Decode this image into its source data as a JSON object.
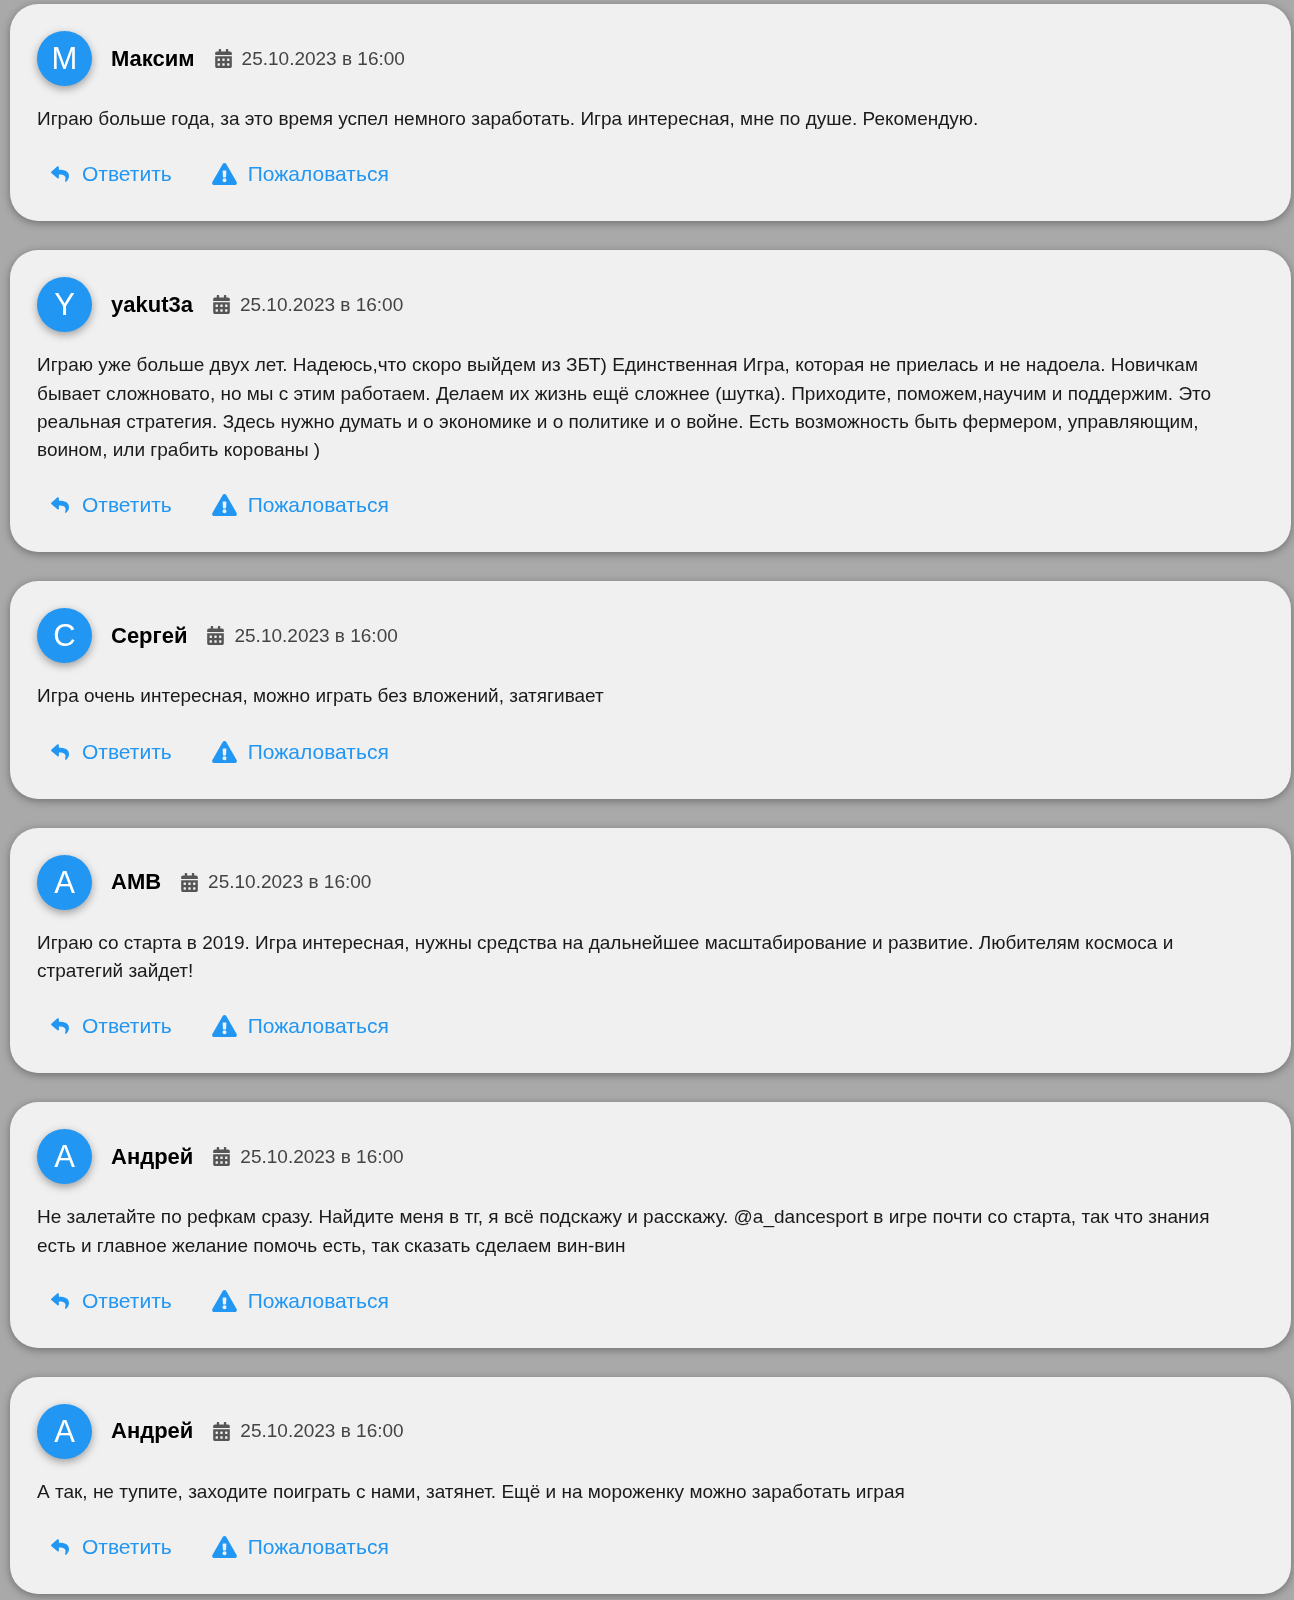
{
  "comments": [
    {
      "avatar_letter": "М",
      "author": "Максим",
      "date": "25.10.2023 в 16:00",
      "text": "Играю больше года, за это время успел немного заработать. Игра интересная, мне по душе. Рекомендую.",
      "actions": [
        {
          "kind": "reply",
          "label": "Ответить"
        },
        {
          "kind": "report",
          "label": "Пожаловаться"
        }
      ]
    },
    {
      "avatar_letter": "Y",
      "author": "yakut3a",
      "date": "25.10.2023 в 16:00",
      "text": "Играю уже больше двух лет. Надеюсь,что скоро выйдем из ЗБТ) Единственная Игра, которая не приелась и не надоела. Новичкам бывает сложновато, но мы с этим работаем. Делаем их жизнь ещё сложнее (шутка). Приходите, поможем,научим и поддержим. Это реальная стратегия. Здесь нужно думать и о экономике и о политике и о войне. Есть возможность быть фермером, управляющим, воином, или грабить корованы )",
      "actions": [
        {
          "kind": "reply",
          "label": "Ответить"
        },
        {
          "kind": "report",
          "label": "Пожаловаться"
        }
      ]
    },
    {
      "avatar_letter": "С",
      "author": "Сергей",
      "date": "25.10.2023 в 16:00",
      "text": "Игра очень интересная, можно играть без вложений, затягивает",
      "actions": [
        {
          "kind": "reply",
          "label": "Ответить"
        },
        {
          "kind": "report",
          "label": "Пожаловаться"
        }
      ]
    },
    {
      "avatar_letter": "А",
      "author": "АМВ",
      "date": "25.10.2023 в 16:00",
      "text": "Играю со старта в 2019. Игра интересная, нужны средства на дальнейшее масштабирование и развитие. Любителям космоса и стратегий зайдет!",
      "actions": [
        {
          "kind": "reply",
          "label": "Ответить"
        },
        {
          "kind": "report",
          "label": "Пожаловаться"
        }
      ]
    },
    {
      "avatar_letter": "А",
      "author": "Андрей",
      "date": "25.10.2023 в 16:00",
      "text": "Не залетайте по рефкам сразу. Найдите меня в тг, я всё подскажу и расскажу. @a_dancesport в игре почти со старта, так что знания есть и главное желание помочь есть, так сказать сделаем вин-вин",
      "actions": [
        {
          "kind": "reply",
          "label": "Ответить"
        },
        {
          "kind": "report",
          "label": "Пожаловаться"
        }
      ]
    },
    {
      "avatar_letter": "А",
      "author": "Андрей",
      "date": "25.10.2023 в 16:00",
      "text": "А так, не тупите, заходите поиграть с нами, затянет. Ещё и на мороженку можно заработать играя",
      "actions": [
        {
          "kind": "reply",
          "label": "Ответить"
        },
        {
          "kind": "report",
          "label": "Пожаловаться"
        }
      ]
    }
  ]
}
